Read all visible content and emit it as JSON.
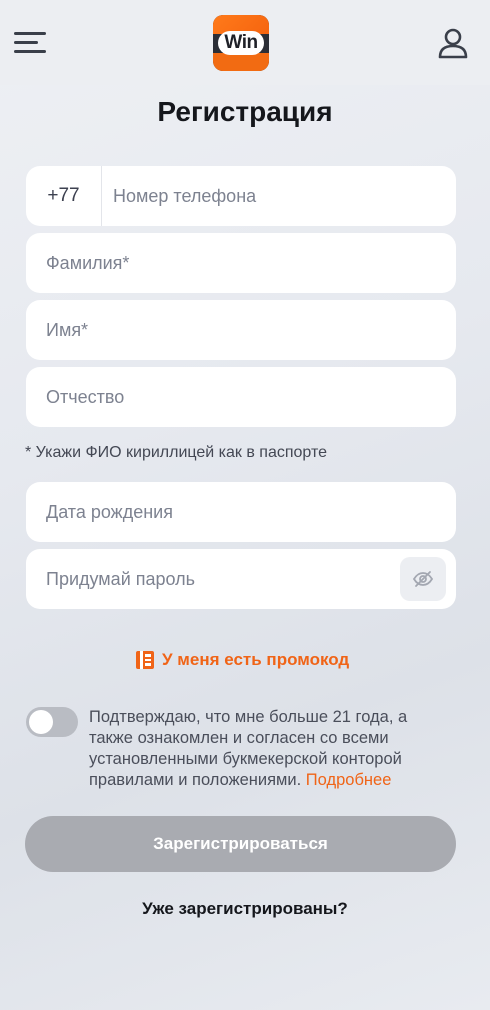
{
  "header": {
    "logo_text": "Win",
    "menu_icon": "hamburger-menu-icon",
    "profile_icon": "user-icon"
  },
  "title": "Регистрация",
  "form": {
    "phone_prefix": "+77",
    "phone_placeholder": "Номер телефона",
    "last_name_placeholder": "Фамилия*",
    "first_name_placeholder": "Имя*",
    "patronymic_placeholder": "Отчество",
    "name_hint": "* Укажи ФИО кириллицей как в паспорте",
    "birthdate_placeholder": "Дата рождения",
    "password_placeholder": "Придумай пароль",
    "password_visibility_icon": "eye-off-icon"
  },
  "promo": {
    "label": "У меня есть промокод",
    "icon": "promo-code-icon"
  },
  "consent": {
    "text": "Подтверждаю, что мне больше 21 года, а также ознакомлен и согласен со всеми установленными букмекерской конторой правилами и положениями.",
    "more_link": "Подробнее",
    "checked": false
  },
  "actions": {
    "submit_label": "Зарегистрироваться",
    "login_link": "Уже зарегистрированы?"
  },
  "colors": {
    "accent": "#f06417",
    "button_disabled": "#a9abb1",
    "background": "#e6e9ef"
  }
}
